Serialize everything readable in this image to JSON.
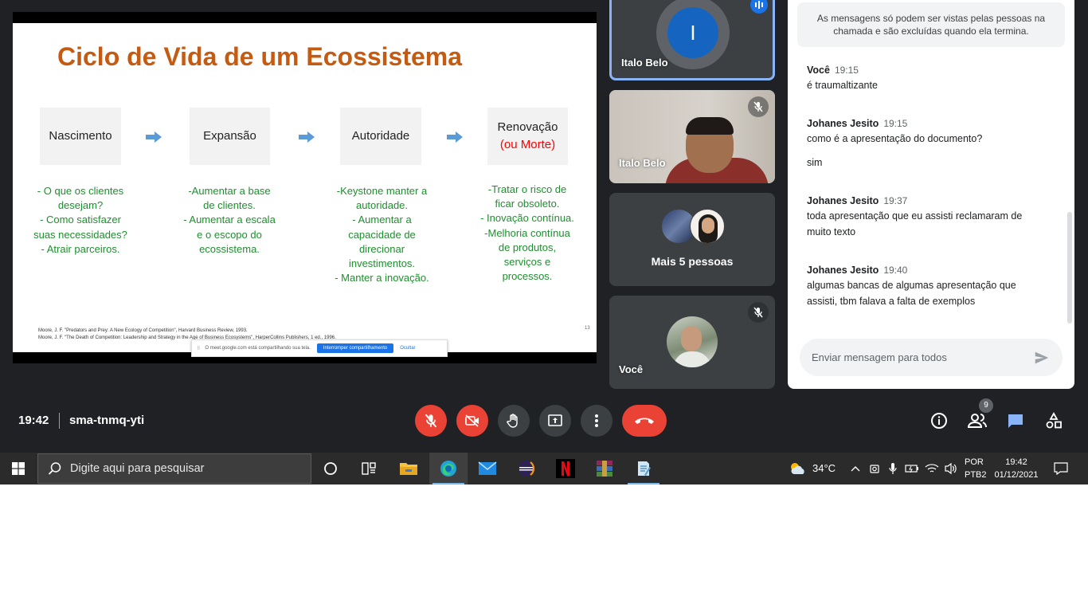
{
  "presentation": {
    "title": "Ciclo de Vida de um Ecossistema",
    "stages": [
      {
        "name": "Nascimento",
        "sub": "",
        "text": "- O que os clientes\ndesejam?\n- Como satisfazer\nsuas necessidades?\n- Atrair parceiros."
      },
      {
        "name": "Expansão",
        "sub": "",
        "text": "-Aumentar a base\nde clientes.\n- Aumentar a escala\ne o escopo do\necossistema."
      },
      {
        "name": "Autoridade",
        "sub": "",
        "text": "-Keystone manter a\nautoridade.\n- Aumentar a\ncapacidade de\ndirecionar\ninvestimentos.\n- Manter a inovação."
      },
      {
        "name": "Renovação",
        "sub": "(ou Morte)",
        "text": "-Tratar o risco de\nficar obsoleto.\n- Inovação contínua.\n-Melhoria contínua\nde produtos,\nserviços e\nprocessos."
      }
    ],
    "references": "Moore, J. F. \"Predators and Prey: A New Ecology of Competition\", Harvard Business Review, 1993.\nMoore, J. F. \"The Death of Competition: Leadership and Strategy in the Age of Business Ecosystems\", HarperCollins Publishers, 1 ed., 1996.",
    "slide_number": "13",
    "share_bar": {
      "message": "O meet.google.com está compartilhando sua tela.",
      "stop_label": "Interromper compartilhamento",
      "hide_label": "Ocultar"
    }
  },
  "tiles": [
    {
      "name": "Italo Belo",
      "avatar_letter": "I",
      "speaking": true
    },
    {
      "name": "Italo Belo",
      "muted": true
    },
    {
      "name": "Mais 5 pessoas"
    },
    {
      "name": "Você",
      "muted": true
    }
  ],
  "chat": {
    "notice": "As mensagens só podem ser vistas pelas pessoas na chamada e são excluídas quando ela termina.",
    "messages": [
      {
        "sender": "Você",
        "time": "19:15",
        "lines": [
          "é traumaltizante"
        ]
      },
      {
        "sender": "Johanes Jesito",
        "time": "19:15",
        "lines": [
          "como é a apresentação do documento?",
          "sim"
        ]
      },
      {
        "sender": "Johanes Jesito",
        "time": "19:37",
        "lines": [
          "toda apresentação que eu assisti reclamaram de muito texto"
        ]
      },
      {
        "sender": "Johanes Jesito",
        "time": "19:40",
        "lines": [
          "algumas bancas de algumas apresentação que assisti, tbm falava a falta de exemplos"
        ]
      }
    ],
    "input_placeholder": "Enviar mensagem para todos"
  },
  "meeting": {
    "time": "19:42",
    "code": "sma-tnmq-yti",
    "participants_count": "9"
  },
  "taskbar": {
    "search_placeholder": "Digite aqui para pesquisar",
    "temperature": "34°C",
    "lang_line1": "POR",
    "lang_line2": "PTB2",
    "clock_time": "19:42",
    "clock_date": "01/12/2021"
  },
  "colors": {
    "meet_bg": "#202124",
    "tile_bg": "#3c4043",
    "danger": "#ea4335",
    "accent_blue": "#1a73e8",
    "slide_title": "#c55a11",
    "slide_body": "#1e8f2e"
  }
}
